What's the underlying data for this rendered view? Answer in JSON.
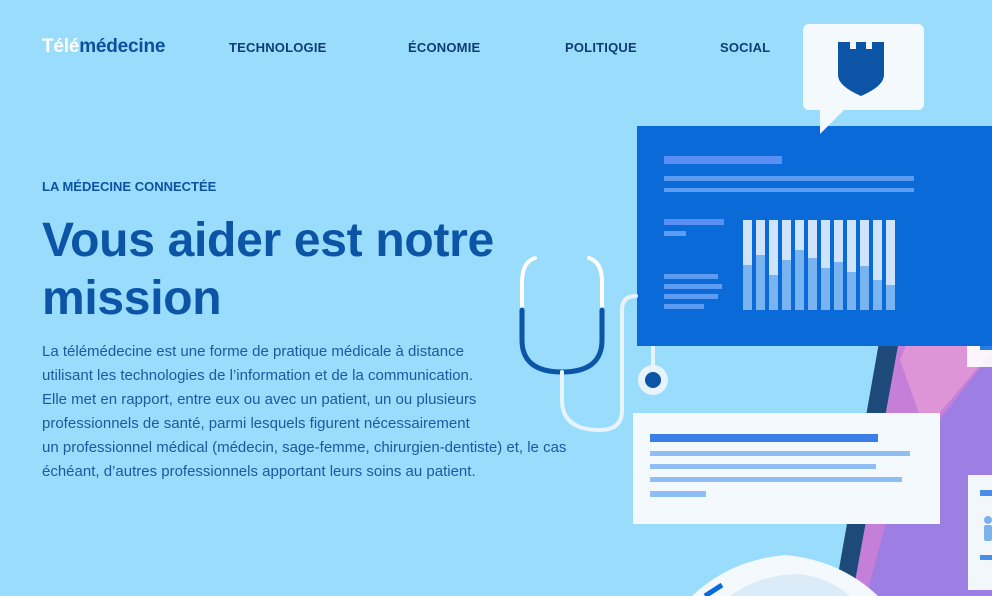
{
  "header": {
    "logo_part1": "Télé",
    "logo_part2": "médecine",
    "nav": [
      "TECHNOLOGIE",
      "ÉCONOMIE",
      "POLITIQUE",
      "SOCIAL"
    ]
  },
  "hero": {
    "eyebrow": "LA MÉDECINE CONNECTÉE",
    "headline_line1": "Vous aider est notre",
    "headline_line2": "mission",
    "description": [
      "La télémédecine est une forme de pratique médicale à distance",
      "utilisant les technologies de l’information et de la communication.",
      "Elle met en rapport, entre eux ou avec un patient, un ou plusieurs",
      "professionnels de santé, parmi lesquels figurent nécessairement",
      "un professionnel médical (médecin, sage-femme, chirurgien-dentiste) et, le cas",
      "échéant, d’autres professionnels apportant leurs soins au patient."
    ]
  },
  "colors": {
    "background": "#9adcfb",
    "primary": "#0b54a6",
    "panel_blue": "#0a6ad8",
    "card_white": "#f3f9fd"
  },
  "icons": [
    "shield-icon",
    "stethoscope-icon",
    "person-icon"
  ]
}
